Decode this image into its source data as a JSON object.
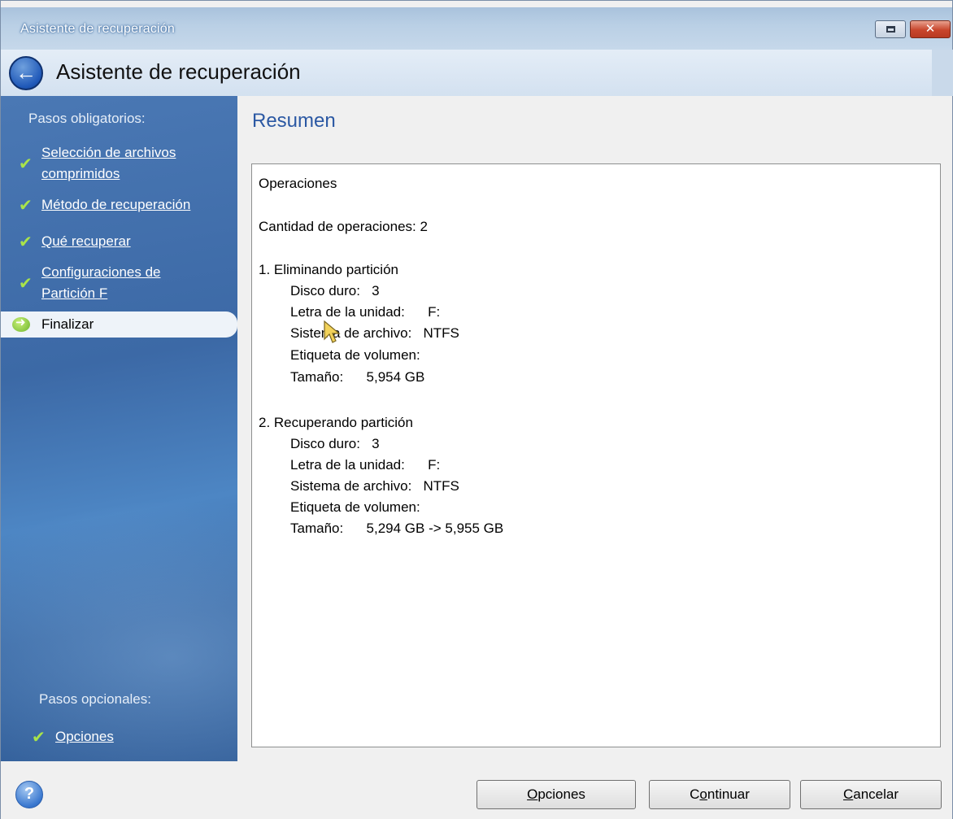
{
  "window": {
    "title": "Asistente de recuperación"
  },
  "header": {
    "title": "Asistente de recuperación",
    "back_icon": "back-arrow-icon"
  },
  "sidebar": {
    "required_heading": "Pasos obligatorios:",
    "steps": [
      {
        "line1": "Selección de archivos",
        "line2": "comprimidos",
        "status": "done"
      },
      {
        "line1": "Método de recuperación",
        "line2": "",
        "status": "done"
      },
      {
        "line1": "Qué recuperar",
        "line2": "",
        "status": "done"
      },
      {
        "line1": "Configuraciones de",
        "line2": "Partición F",
        "status": "done"
      },
      {
        "line1": "Finalizar",
        "line2": "",
        "status": "current"
      }
    ],
    "optional_heading": "Pasos opcionales:",
    "optional_steps": [
      {
        "label": "Opciones",
        "status": "done"
      }
    ]
  },
  "content": {
    "title": "Resumen",
    "summary": {
      "heading": "Operaciones",
      "count_line": "Cantidad de operaciones: 2",
      "operations": [
        {
          "title": "1. Eliminando partición",
          "disk": "Disco duro:   3",
          "drive_letter": "Letra de la unidad:      F:",
          "filesystem": "Sistema de archivo:   NTFS",
          "volume_label": "Etiqueta de volumen:",
          "size": "Tamaño:      5,954 GB"
        },
        {
          "title": "2. Recuperando partición",
          "disk": "Disco duro:   3",
          "drive_letter": "Letra de la unidad:      F:",
          "filesystem": "Sistema de archivo:   NTFS",
          "volume_label": "Etiqueta de volumen:",
          "size": "Tamaño:      5,294 GB -> 5,955 GB"
        }
      ]
    }
  },
  "footer": {
    "options_button": {
      "access": "O",
      "rest": "pciones"
    },
    "continue_button": {
      "pre": "C",
      "access": "o",
      "rest": "ntinuar"
    },
    "cancel_button": {
      "access": "C",
      "rest": "ancelar"
    }
  },
  "colors": {
    "sidebar_bg": "#3c69a6",
    "title_accent": "#2b58a3",
    "check_green": "#a9e44a"
  }
}
